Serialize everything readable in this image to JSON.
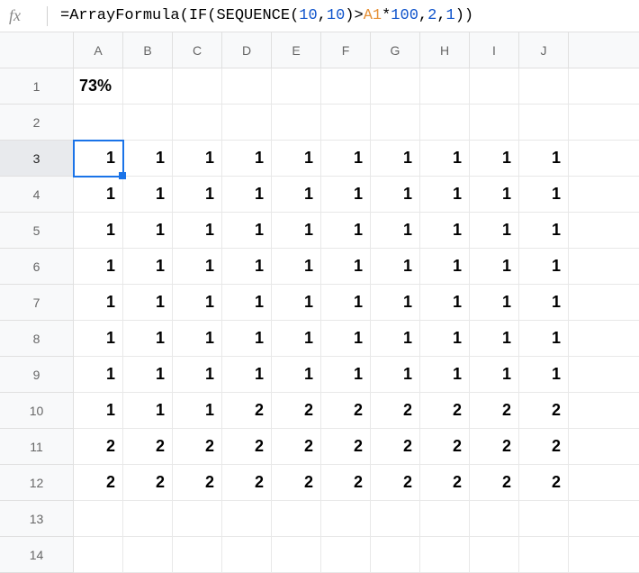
{
  "formula_bar": {
    "fx_label": "fx",
    "eq": "=",
    "fn1": "ArrayFormula",
    "open1": "(",
    "fn2": "IF",
    "open2": "(",
    "fn3": "SEQUENCE",
    "open3": "(",
    "num_a": "10",
    "comma1": ",",
    "num_b": "10",
    "close3": ")",
    "gt": ">",
    "ref": "A1",
    "star": "*",
    "num_c": "100",
    "comma2": ",",
    "num_d": "2",
    "comma3": ",",
    "num_e": "1",
    "close2": ")",
    "close1": ")"
  },
  "columns": [
    "A",
    "B",
    "C",
    "D",
    "E",
    "F",
    "G",
    "H",
    "I",
    "J"
  ],
  "rows": [
    "1",
    "2",
    "3",
    "4",
    "5",
    "6",
    "7",
    "8",
    "9",
    "10",
    "11",
    "12",
    "13",
    "14"
  ],
  "selected_cell": "A3",
  "a1_value": "73%",
  "grid": [
    [
      "1",
      "1",
      "1",
      "1",
      "1",
      "1",
      "1",
      "1",
      "1",
      "1"
    ],
    [
      "1",
      "1",
      "1",
      "1",
      "1",
      "1",
      "1",
      "1",
      "1",
      "1"
    ],
    [
      "1",
      "1",
      "1",
      "1",
      "1",
      "1",
      "1",
      "1",
      "1",
      "1"
    ],
    [
      "1",
      "1",
      "1",
      "1",
      "1",
      "1",
      "1",
      "1",
      "1",
      "1"
    ],
    [
      "1",
      "1",
      "1",
      "1",
      "1",
      "1",
      "1",
      "1",
      "1",
      "1"
    ],
    [
      "1",
      "1",
      "1",
      "1",
      "1",
      "1",
      "1",
      "1",
      "1",
      "1"
    ],
    [
      "1",
      "1",
      "1",
      "1",
      "1",
      "1",
      "1",
      "1",
      "1",
      "1"
    ],
    [
      "1",
      "1",
      "1",
      "2",
      "2",
      "2",
      "2",
      "2",
      "2",
      "2"
    ],
    [
      "2",
      "2",
      "2",
      "2",
      "2",
      "2",
      "2",
      "2",
      "2",
      "2"
    ],
    [
      "2",
      "2",
      "2",
      "2",
      "2",
      "2",
      "2",
      "2",
      "2",
      "2"
    ]
  ]
}
